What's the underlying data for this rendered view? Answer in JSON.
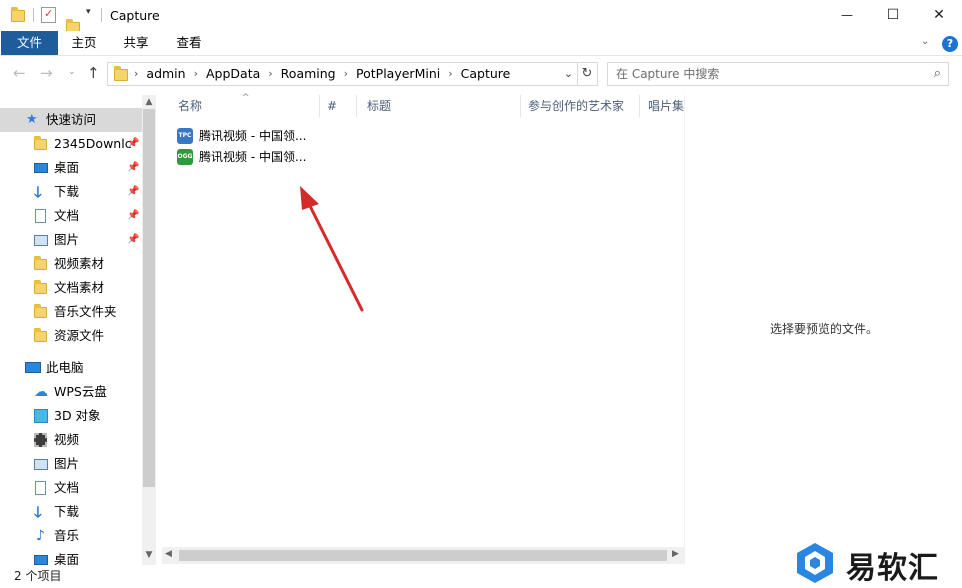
{
  "window": {
    "title": "Capture",
    "controls": {
      "minimize": "—",
      "maximize": "☐",
      "close": "✕"
    }
  },
  "ribbon": {
    "tabs": [
      {
        "label": "文件"
      },
      {
        "label": "主页"
      },
      {
        "label": "共享"
      },
      {
        "label": "查看"
      }
    ],
    "help": "?"
  },
  "address": {
    "crumbs": [
      "admin",
      "AppData",
      "Roaming",
      "PotPlayerMini",
      "Capture"
    ],
    "search_placeholder": "在 Capture 中搜索"
  },
  "nav": {
    "quick_access": {
      "label": "快速访问",
      "items": [
        {
          "label": "2345Downlc",
          "pinned": true,
          "icon": "folder-icon"
        },
        {
          "label": "桌面",
          "pinned": true,
          "icon": "desktop-icon"
        },
        {
          "label": "下载",
          "pinned": true,
          "icon": "download-icon"
        },
        {
          "label": "文档",
          "pinned": true,
          "icon": "document-icon"
        },
        {
          "label": "图片",
          "pinned": true,
          "icon": "picture-icon"
        },
        {
          "label": "视频素材",
          "pinned": false,
          "icon": "folder-icon"
        },
        {
          "label": "文档素材",
          "pinned": false,
          "icon": "folder-icon"
        },
        {
          "label": "音乐文件夹",
          "pinned": false,
          "icon": "folder-icon"
        },
        {
          "label": "资源文件",
          "pinned": false,
          "icon": "folder-icon"
        }
      ]
    },
    "this_pc": {
      "label": "此电脑",
      "items": [
        {
          "label": "WPS云盘",
          "icon": "cloud-icon"
        },
        {
          "label": "3D 对象",
          "icon": "cube-icon"
        },
        {
          "label": "视频",
          "icon": "video-icon"
        },
        {
          "label": "图片",
          "icon": "picture-icon"
        },
        {
          "label": "文档",
          "icon": "document-icon"
        },
        {
          "label": "下载",
          "icon": "download-icon"
        },
        {
          "label": "音乐",
          "icon": "music-icon"
        },
        {
          "label": "桌面",
          "icon": "desktop-icon"
        }
      ]
    }
  },
  "columns": {
    "name": "名称",
    "num": "#",
    "title": "标题",
    "artist": "参与创作的艺术家",
    "album": "唱片集"
  },
  "files": [
    {
      "name": "腾讯视频 - 中国领...",
      "icon": "tpc-file-icon",
      "badge": "TPC",
      "color": "#3b76c2"
    },
    {
      "name": "腾讯视频 - 中国领...",
      "icon": "ogg-file-icon",
      "badge": "OGG",
      "color": "#2f9a3c"
    }
  ],
  "preview": {
    "message": "选择要预览的文件。"
  },
  "status": {
    "item_count": "2 个项目"
  },
  "watermark": {
    "text": "易软汇"
  },
  "colors": {
    "file_tab": "#1e5c9c",
    "selected_nav": "#d9d9d9",
    "arrow": "#d42a2a"
  }
}
